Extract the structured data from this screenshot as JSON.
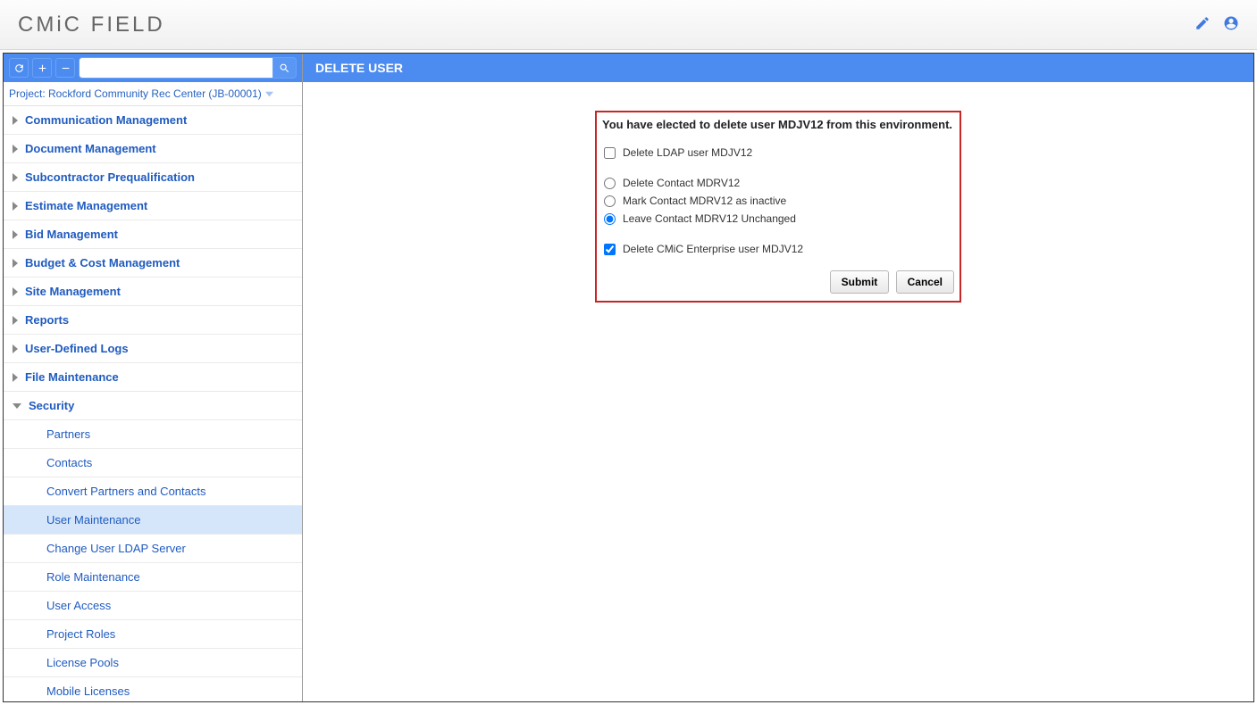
{
  "header": {
    "title": "CMiC FIELD"
  },
  "sidebar": {
    "project_label": "Project: Rockford Community Rec Center (JB-00001)",
    "nodes": [
      {
        "label": "Communication Management",
        "expanded": false
      },
      {
        "label": "Document Management",
        "expanded": false
      },
      {
        "label": "Subcontractor Prequalification",
        "expanded": false
      },
      {
        "label": "Estimate Management",
        "expanded": false
      },
      {
        "label": "Bid Management",
        "expanded": false
      },
      {
        "label": "Budget & Cost Management",
        "expanded": false
      },
      {
        "label": "Site Management",
        "expanded": false
      },
      {
        "label": "Reports",
        "expanded": false
      },
      {
        "label": "User-Defined Logs",
        "expanded": false
      },
      {
        "label": "File Maintenance",
        "expanded": false
      },
      {
        "label": "Security",
        "expanded": true
      }
    ],
    "security_children": [
      {
        "label": "Partners",
        "active": false
      },
      {
        "label": "Contacts",
        "active": false
      },
      {
        "label": "Convert Partners and Contacts",
        "active": false
      },
      {
        "label": "User Maintenance",
        "active": true
      },
      {
        "label": "Change User LDAP Server",
        "active": false
      },
      {
        "label": "Role Maintenance",
        "active": false
      },
      {
        "label": "User Access",
        "active": false
      },
      {
        "label": "Project Roles",
        "active": false
      },
      {
        "label": "License Pools",
        "active": false
      },
      {
        "label": "Mobile Licenses",
        "active": false
      }
    ]
  },
  "main": {
    "title": "DELETE USER",
    "dialog": {
      "message": "You have elected to delete user MDJV12 from this environment.",
      "ldap_label": "Delete LDAP user MDJV12",
      "ldap_checked": false,
      "contact_options": [
        {
          "label": "Delete Contact MDRV12",
          "selected": false
        },
        {
          "label": "Mark Contact MDRV12 as inactive",
          "selected": false
        },
        {
          "label": "Leave Contact MDRV12 Unchanged",
          "selected": true
        }
      ],
      "enterprise_label": "Delete CMiC Enterprise user MDJV12",
      "enterprise_checked": true,
      "submit_label": "Submit",
      "cancel_label": "Cancel"
    }
  }
}
